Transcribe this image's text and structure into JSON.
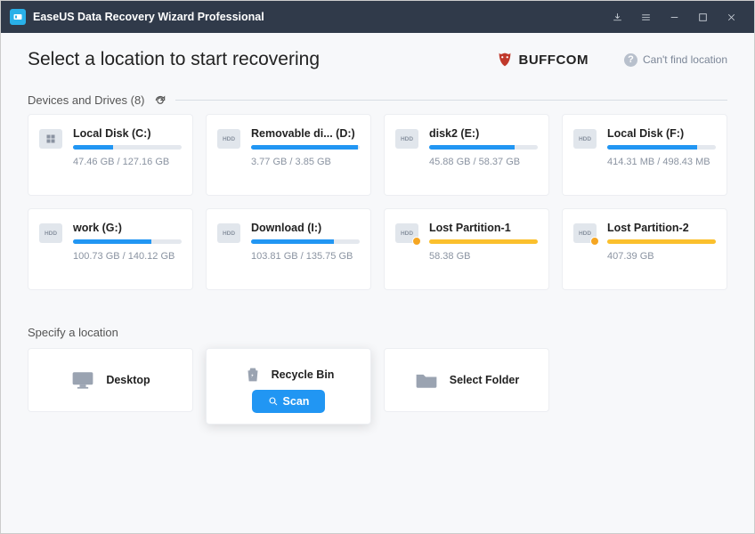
{
  "titlebar": {
    "title": "EaseUS Data Recovery Wizard Professional"
  },
  "header": {
    "heading": "Select a location to start recovering",
    "logo_text": "BUFFCOM",
    "help_link": "Can't find location"
  },
  "devices_section": {
    "label_prefix": "Devices and Drives",
    "count": "(8)"
  },
  "drives": [
    {
      "name": "Local Disk (C:)",
      "stats": "47.46 GB / 127.16 GB",
      "pct": 37,
      "icon": "win",
      "warn": false,
      "lost": false
    },
    {
      "name": "Removable di... (D:)",
      "stats": "3.77 GB / 3.85 GB",
      "pct": 98,
      "icon": "hdd",
      "warn": false,
      "lost": false
    },
    {
      "name": "disk2 (E:)",
      "stats": "45.88 GB / 58.37 GB",
      "pct": 79,
      "icon": "hdd",
      "warn": false,
      "lost": false
    },
    {
      "name": "Local Disk (F:)",
      "stats": "414.31 MB / 498.43 MB",
      "pct": 83,
      "icon": "hdd",
      "warn": false,
      "lost": false
    },
    {
      "name": "work (G:)",
      "stats": "100.73 GB / 140.12 GB",
      "pct": 72,
      "icon": "hdd",
      "warn": false,
      "lost": false
    },
    {
      "name": "Download (I:)",
      "stats": "103.81 GB / 135.75 GB",
      "pct": 76,
      "icon": "hdd",
      "warn": false,
      "lost": false
    },
    {
      "name": "Lost Partition-1",
      "stats": "58.38 GB",
      "pct": 100,
      "icon": "hdd",
      "warn": true,
      "lost": true
    },
    {
      "name": "Lost Partition-2",
      "stats": "407.39 GB",
      "pct": 100,
      "icon": "hdd",
      "warn": true,
      "lost": true
    }
  ],
  "specify_section": {
    "label": "Specify a location"
  },
  "locations": {
    "desktop": "Desktop",
    "recycle_bin": "Recycle Bin",
    "select_folder": "Select Folder",
    "scan_button": "Scan"
  }
}
